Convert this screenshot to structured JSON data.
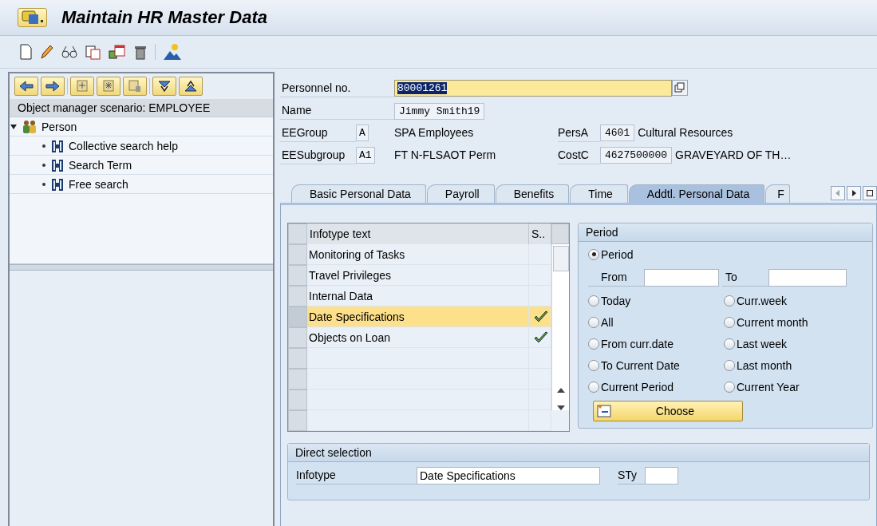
{
  "window": {
    "title": "Maintain HR Master Data"
  },
  "object_manager": {
    "header": "Object manager scenario: EMPLOYEE",
    "tree": [
      {
        "label": "Person",
        "expanded": true,
        "children": [
          {
            "label": "Collective search help"
          },
          {
            "label": "Search Term"
          },
          {
            "label": "Free search"
          }
        ]
      }
    ]
  },
  "personnel_no": {
    "label": "Personnel no.",
    "value": "80001261"
  },
  "name": {
    "label": "Name",
    "value": "Jimmy Smith19"
  },
  "ee_group": {
    "label": "EEGroup",
    "code": "A",
    "text": "SPA Employees"
  },
  "pers_area": {
    "label": "PersA",
    "code": "4601",
    "text": "Cultural Resources"
  },
  "ee_subgroup": {
    "label": "EESubgroup",
    "code": "A1",
    "text": "FT N-FLSAOT Perm"
  },
  "cost_center": {
    "label": "CostC",
    "code": "4627500000",
    "text": "GRAVEYARD OF TH…"
  },
  "tabs": [
    {
      "label": "Basic Personal Data",
      "selected": false
    },
    {
      "label": "Payroll",
      "selected": false
    },
    {
      "label": "Benefits",
      "selected": false
    },
    {
      "label": "Time",
      "selected": false
    },
    {
      "label": "Addtl. Personal Data",
      "selected": true
    },
    {
      "label": "F",
      "selected": false
    }
  ],
  "infotype_table": {
    "columns": [
      "Infotype text",
      "S.."
    ],
    "rows": [
      {
        "text": "Monitoring of Tasks",
        "selected": false,
        "checked": false
      },
      {
        "text": "Travel Privileges",
        "selected": false,
        "checked": false
      },
      {
        "text": "Internal Data",
        "selected": false,
        "checked": false
      },
      {
        "text": "Date Specifications",
        "selected": true,
        "checked": true
      },
      {
        "text": "Objects on Loan",
        "selected": false,
        "checked": true
      }
    ]
  },
  "period": {
    "title": "Period",
    "from_label": "From",
    "to_label": "To",
    "button": "Choose",
    "options": [
      {
        "label": "Period",
        "selected": true
      },
      {
        "label": "Today",
        "selected": false
      },
      {
        "label": "Curr.week",
        "selected": false
      },
      {
        "label": "All",
        "selected": false
      },
      {
        "label": "Current month",
        "selected": false
      },
      {
        "label": "From curr.date",
        "selected": false
      },
      {
        "label": "Last week",
        "selected": false
      },
      {
        "label": "To Current Date",
        "selected": false
      },
      {
        "label": "Last month",
        "selected": false
      },
      {
        "label": "Current Period",
        "selected": false
      },
      {
        "label": "Current Year",
        "selected": false
      }
    ]
  },
  "direct_selection": {
    "title": "Direct selection",
    "infotype_label": "Infotype",
    "infotype_value": "Date Specifications",
    "sty_label": "STy"
  }
}
